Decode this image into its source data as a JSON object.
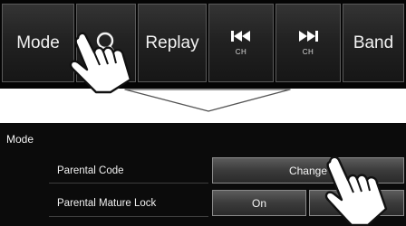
{
  "top_bar": {
    "mode_label": "Mode",
    "search_icon": "search-icon",
    "replay_label": "Replay",
    "prev_icon": "skip-previous-icon",
    "prev_sub": "CH",
    "next_icon": "skip-next-icon",
    "next_sub": "CH",
    "band_label": "Band"
  },
  "mode_panel": {
    "title": "Mode",
    "rows": [
      {
        "label": "Parental Code",
        "button": "Change"
      },
      {
        "label": "Parental Mature Lock",
        "on_label": "On"
      }
    ]
  },
  "colors": {
    "bar_background": "#050505",
    "button_text": "#f2f2f2",
    "panel_background": "#0b0b0b"
  }
}
